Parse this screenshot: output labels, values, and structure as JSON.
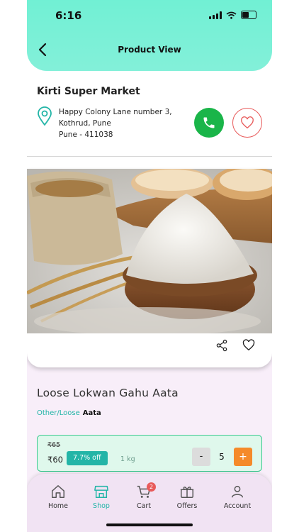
{
  "status_bar": {
    "time": "6:16"
  },
  "header": {
    "title": "Product View"
  },
  "store": {
    "name": "Kirti Super Market",
    "address_lines": [
      "Happy Colony Lane number 3,",
      "Kothrud, Pune",
      "Pune - 411038"
    ]
  },
  "product": {
    "name": "Loose Lokwan Gahu Aata",
    "category_path": "Other/Loose",
    "category_name": "Aata",
    "mrp": "₹65",
    "price": "₹60",
    "discount": "7.7% off",
    "unit": "1 kg",
    "quantity": "5"
  },
  "controls": {
    "minus": "-",
    "plus": "+"
  },
  "bottom_nav": {
    "items": [
      {
        "label": "Home",
        "icon": "home-icon"
      },
      {
        "label": "Shop",
        "icon": "shop-icon",
        "active": true
      },
      {
        "label": "Cart",
        "icon": "cart-icon",
        "badge": "2"
      },
      {
        "label": "Offers",
        "icon": "offers-icon"
      },
      {
        "label": "Account",
        "icon": "account-icon"
      }
    ]
  },
  "colors": {
    "header": "#71f0d4",
    "accent": "#23b5a7",
    "call": "#1ab549",
    "plus": "#f58a2a",
    "badge": "#e85a5a"
  }
}
